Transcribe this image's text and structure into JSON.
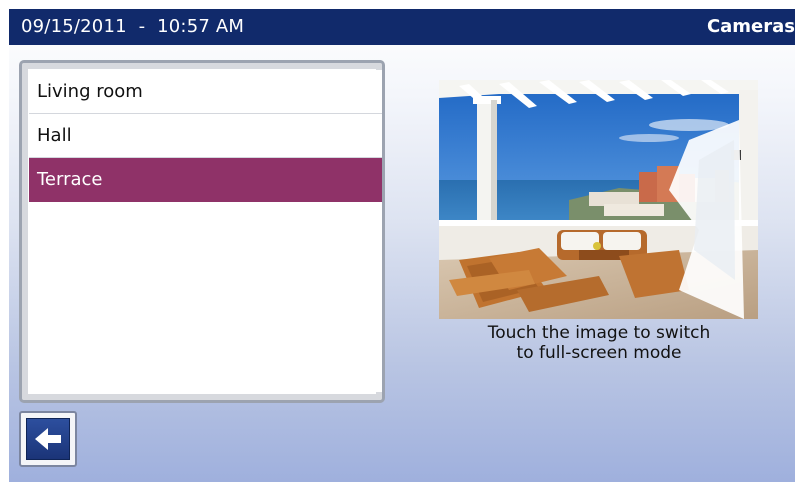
{
  "header": {
    "datetime": "09/15/2011  -  10:57 AM",
    "title": "Cameras",
    "background_color": "#112a6b"
  },
  "camera_list": {
    "items": [
      {
        "label": "Living room",
        "selected": false
      },
      {
        "label": "Hall",
        "selected": false
      },
      {
        "label": "Terrace",
        "selected": true
      }
    ],
    "selected_color": "#8f3268"
  },
  "preview": {
    "caption_line1": "Touch the image to switch",
    "caption_line2": "to full-screen mode"
  },
  "footer": {
    "back_icon": "arrow-left-icon"
  }
}
